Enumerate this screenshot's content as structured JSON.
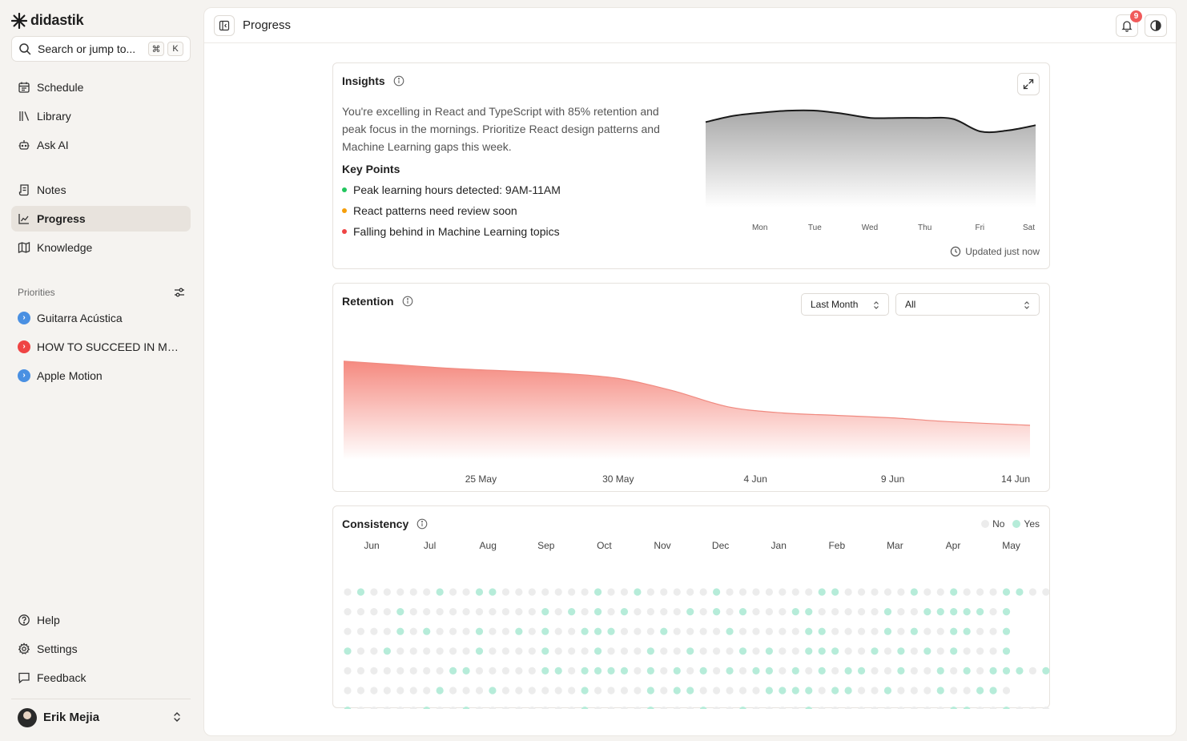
{
  "app": {
    "name": "didastik"
  },
  "search": {
    "placeholder": "Search or jump to...",
    "kbd1": "⌘",
    "kbd2": "K"
  },
  "nav": {
    "primary": [
      {
        "label": "Schedule",
        "icon": "calendar-icon"
      },
      {
        "label": "Library",
        "icon": "library-icon"
      },
      {
        "label": "Ask AI",
        "icon": "bot-icon"
      }
    ],
    "secondary": [
      {
        "label": "Notes",
        "icon": "notes-icon"
      },
      {
        "label": "Progress",
        "icon": "chart-icon",
        "active": true
      },
      {
        "label": "Knowledge",
        "icon": "map-icon"
      }
    ]
  },
  "priorities": {
    "label": "Priorities",
    "items": [
      {
        "label": "Guitarra Acústica",
        "color": "#4a90e2"
      },
      {
        "label": "HOW TO SUCCEED IN MRBEAST PRODUCTION",
        "color": "#ef4444"
      },
      {
        "label": "Apple Motion",
        "color": "#4a90e2"
      }
    ]
  },
  "footer_nav": [
    {
      "label": "Help",
      "icon": "help-icon"
    },
    {
      "label": "Settings",
      "icon": "gear-icon"
    },
    {
      "label": "Feedback",
      "icon": "message-icon"
    }
  ],
  "user": {
    "name": "Erik Mejia"
  },
  "header": {
    "title": "Progress",
    "notifications": "9"
  },
  "insights": {
    "title": "Insights",
    "summary": "You're excelling in React and TypeScript with 85% retention and peak focus in the mornings. Prioritize React design patterns and Machine Learning gaps this week.",
    "key_points_title": "Key Points",
    "key_points": [
      {
        "text": "Peak learning hours detected: 9AM-11AM",
        "color": "#22c55e"
      },
      {
        "text": "React patterns need review soon",
        "color": "#f59e0b"
      },
      {
        "text": "Falling behind in Machine Learning topics",
        "color": "#ef4444"
      }
    ],
    "updated": "Updated just now"
  },
  "retention": {
    "title": "Retention",
    "period": "Last Month",
    "filter": "All"
  },
  "consistency": {
    "title": "Consistency",
    "legend_no": "No",
    "legend_yes": "Yes",
    "months": [
      "Jun",
      "Jul",
      "Aug",
      "Sep",
      "Oct",
      "Nov",
      "Dec",
      "Jan",
      "Feb",
      "Mar",
      "Apr",
      "May"
    ],
    "colors": {
      "yes": "#b6ecd9",
      "no": "#ececec"
    },
    "rows": [
      "0100000100110000000100100000100000001100000100100011000",
      "000010000000000101010100001010100011000001001111101",
      "000010100010010100111000100001000001100001010011001",
      "100100000010000100010001001000101001110010101010001",
      "000000001100000110111101010101011010101100100101011101",
      "000000010001000000100001011000001111011001000100110",
      "100000100100000000100001000100100001000000000011001000000"
    ]
  },
  "chart_data": [
    {
      "type": "area",
      "title": "",
      "categories": [
        "Mon",
        "Tue",
        "Wed",
        "Thu",
        "Fri",
        "Sat"
      ],
      "x": [
        0,
        0.5,
        1,
        1.5,
        2,
        2.5,
        3,
        3.5,
        4,
        4.5,
        5,
        5.5,
        6
      ],
      "values": [
        0.82,
        0.88,
        0.91,
        0.93,
        0.93,
        0.9,
        0.86,
        0.86,
        0.86,
        0.85,
        0.73,
        0.74,
        0.79
      ]
    },
    {
      "type": "area",
      "title": "",
      "xlabel": "",
      "ticks": [
        "25 May",
        "30 May",
        "4 Jun",
        "9 Jun",
        "14 Jun"
      ],
      "x": [
        "2025-05-20",
        "2025-05-22",
        "2025-05-24",
        "2025-05-26",
        "2025-05-28",
        "2025-05-30",
        "2025-06-01",
        "2025-06-03",
        "2025-06-05",
        "2025-06-07",
        "2025-06-09",
        "2025-06-11",
        "2025-06-14"
      ],
      "values": [
        0.8,
        0.77,
        0.74,
        0.72,
        0.7,
        0.66,
        0.56,
        0.43,
        0.38,
        0.36,
        0.34,
        0.31,
        0.28
      ]
    }
  ]
}
